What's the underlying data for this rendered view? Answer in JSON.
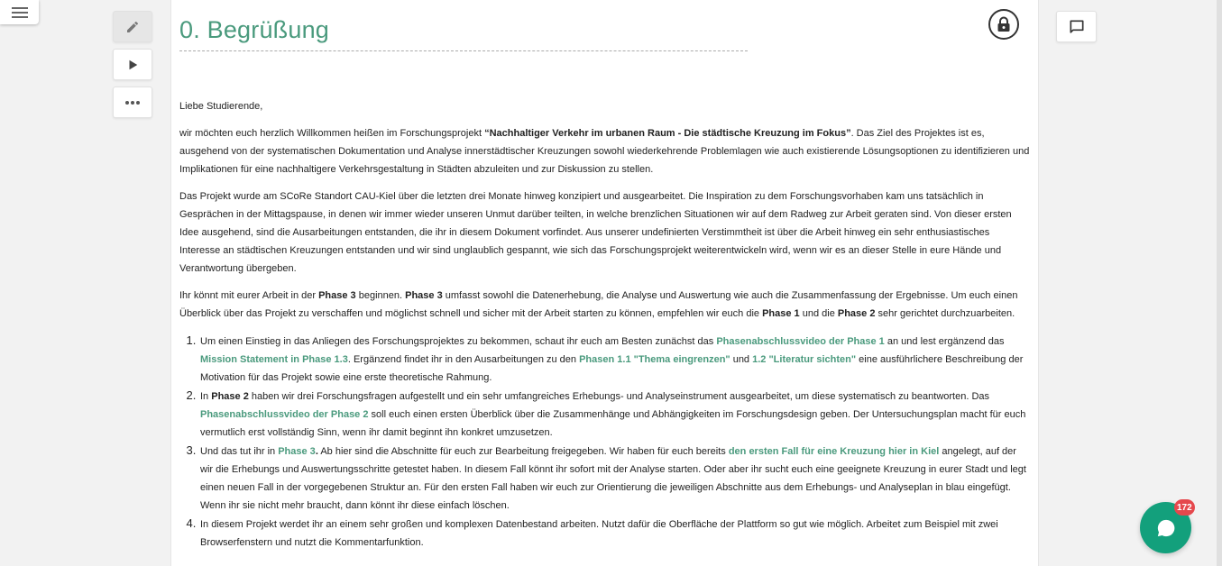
{
  "sidebar": {
    "menu_icon": "hamburger-icon"
  },
  "toolbar": {
    "edit_icon": "pencil-icon",
    "play_icon": "play-icon",
    "more_icon": "more-horizontal-icon"
  },
  "document": {
    "title": "0. Begrüßung",
    "lock_icon": "lock-icon",
    "greeting": "Liebe Studierende,",
    "p1": {
      "t1": "wir möchten euch herzlich Willkommen heißen im Forschungsprojekt ",
      "b1": "“Nachhaltiger Verkehr im urbanen Raum - Die städtische Kreuzung im Fokus”",
      "t2": ". Das Ziel des Projektes ist es, ausgehend von der systematischen Dokumentation und Analyse innerstädtischer Kreuzungen sowohl wiederkehrende Problemlagen wie auch existierende Lösungsoptionen zu identifizieren und Implikationen für eine nachhaltigere Verkehrsgestaltung in Städten abzuleiten und zur Diskussion zu stellen."
    },
    "p2": "Das Projekt wurde am SCoRe Standort CAU-Kiel über die letzten drei Monate hinweg konzipiert und ausgearbeitet. Die Inspiration zu dem Forschungsvorhaben kam uns tatsächlich in Gesprächen in der Mittagspause, in denen wir immer wieder unseren Unmut darüber teilten, in welche brenzlichen Situationen wir auf dem Radweg zur Arbeit geraten sind. Von dieser ersten Idee ausgehend, sind die Ausarbeitungen entstanden, die ihr in diesem Dokument vorfindet. Aus unserer undefinierten Verstimmtheit ist über die Arbeit hinweg ein sehr enthusiastisches Interesse an städtischen Kreuzungen entstanden und wir sind unglaublich gespannt, wie sich das Forschungsprojekt weiterentwickeln wird, wenn wir es an dieser Stelle in eure Hände und Verantwortung übergeben.",
    "p3": {
      "t1": "Ihr könnt mit eurer Arbeit in der ",
      "b1": "Phase 3",
      "t2": " beginnen. ",
      "b2": "Phase 3",
      "t3": " umfasst sowohl die Datenerhebung, die Analyse und Auswertung wie auch die Zusammenfassung der Ergebnisse. Um euch einen Überblick über das Projekt zu verschaffen und möglichst schnell und sicher mit der Arbeit starten zu können, empfehlen wir euch die ",
      "b3": "Phase 1",
      "t4": " und die ",
      "b4": "Phase 2",
      "t5": " sehr gerichtet durchzuarbeiten."
    },
    "list": {
      "i1": {
        "t1": "Um einen Einstieg in das Anliegen des Forschungsprojektes zu bekommen, schaut ihr euch am Besten zunächst das ",
        "l1": "Phasenabschlussvideo der Phase 1",
        "t2": " an und lest ergänzend das ",
        "l2": "Mission Statement in Phase 1.3",
        "t3": ". Ergänzend findet ihr in den Ausarbeitungen zu den ",
        "l3": "Phasen 1.1 \"Thema eingrenzen\"",
        "t4": " und ",
        "l4": "1.2 \"Literatur sichten\"",
        "t5": " eine ausführlichere Beschreibung der Motivation für das Projekt sowie eine erste theoretische Rahmung."
      },
      "i2": {
        "t1": "In ",
        "b1": "Phase 2",
        "t2": " haben wir drei Forschungsfragen aufgestellt und ein sehr umfangreiches Erhebungs- und Analyseinstrument ausgearbeitet, um diese systematisch zu beantworten. Das ",
        "l1": "Phasenabschlussvideo der Phase 2",
        "t3": " soll euch einen ersten Überblick über die Zusammenhänge und Abhängigkeiten im Forschungsdesign geben. Der Untersuchungsplan macht für euch vermutlich erst vollständig Sinn, wenn ihr damit beginnt ihn konkret umzusetzen."
      },
      "i3": {
        "t1": "Und das tut ihr in ",
        "l1": "Phase 3",
        "b1": ".",
        "t2": " Ab hier sind die Abschnitte für euch zur Bearbeitung freigegeben. Wir haben für euch bereits ",
        "l2": "den ersten Fall für eine Kreuzung hier in Kiel",
        "t3": " angelegt, auf der wir die Erhebungs und Auswertungsschritte getestet haben. In diesem Fall könnt ihr sofort mit der Analyse starten. Oder aber ihr sucht euch eine geeignete Kreuzung in eurer Stadt und legt einen neuen Fall in der vorgegebenen Struktur an. Für den ersten Fall haben wir euch zur Orientierung die jeweiligen Abschnitte aus dem Erhebungs- und Analyseplan in blau eingefügt. Wenn ihr sie nicht mehr braucht, dann könnt ihr diese einfach löschen."
      },
      "i4": {
        "t1": "In diesem Projekt werdet ihr an einem sehr großen und komplexen Datenbestand arbeiten. Nutzt dafür die Oberfläche der Plattform so gut wie möglich. Arbeitet zum Beispiel mit zwei Browserfenstern und nutzt die Kommentarfunktion."
      }
    }
  },
  "comments": {
    "icon": "comment-icon"
  },
  "chat": {
    "icon": "chat-bubble-icon",
    "badge": "172"
  }
}
